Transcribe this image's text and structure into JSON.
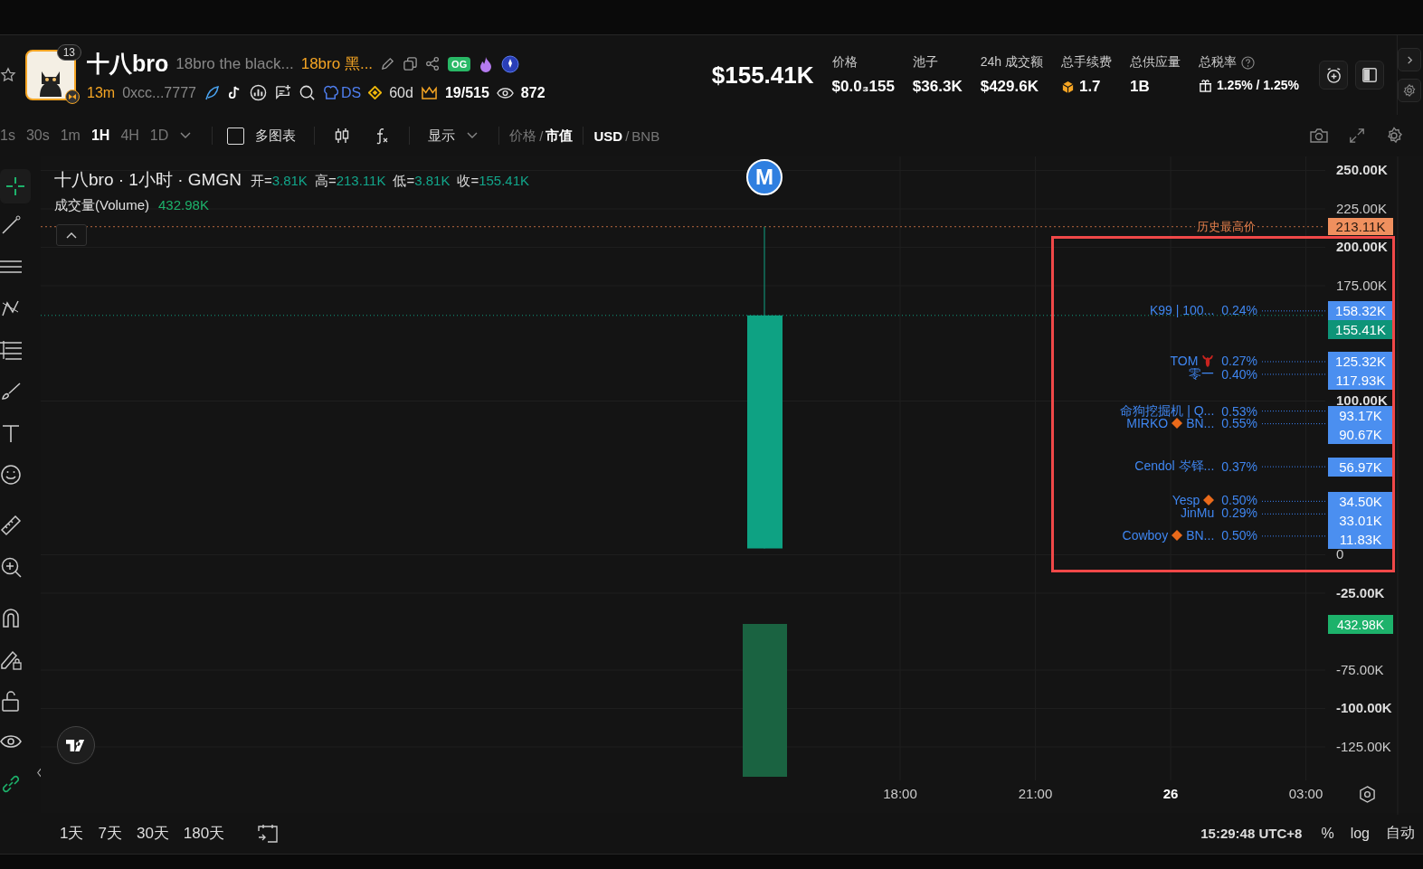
{
  "token": {
    "name": "十八bro",
    "full_name": "18bro the black...",
    "alias": "18bro 黑...",
    "badge": "OG",
    "avatar_badge": "13",
    "age": "13m",
    "address": "0xcc...7777",
    "ds_label": "DS",
    "listing_age": "60d",
    "holders_rank": "19/515",
    "views": "872"
  },
  "market_cap": "$155.41K",
  "stats": [
    {
      "label": "价格",
      "value": "$0.0₃155",
      "kind": "plain"
    },
    {
      "label": "池子",
      "value": "$36.3K",
      "kind": "plain"
    },
    {
      "label": "24h 成交额",
      "value": "$429.6K",
      "kind": "plain"
    },
    {
      "label": "总手续费",
      "value": "1.7",
      "kind": "fee"
    },
    {
      "label": "总供应量",
      "value": "1B",
      "kind": "plain"
    },
    {
      "label": "总税率",
      "value": "1.25% / 1.25%",
      "kind": "tax"
    }
  ],
  "intervals": [
    {
      "label": "1s",
      "selected": false
    },
    {
      "label": "30s",
      "selected": false
    },
    {
      "label": "1m",
      "selected": false
    },
    {
      "label": "1H",
      "selected": true
    },
    {
      "label": "4H",
      "selected": false
    },
    {
      "label": "1D",
      "selected": false
    }
  ],
  "toolbar": {
    "multi_chart": {
      "label": "多图表",
      "checked": false
    },
    "display": "显示",
    "separator": "/",
    "price_mode": [
      {
        "label": "价格",
        "selected": false
      },
      {
        "label": "市值",
        "selected": true
      }
    ],
    "currency": [
      {
        "label": "USD",
        "selected": true
      },
      {
        "label": "BNB",
        "selected": false
      }
    ]
  },
  "legend": {
    "title": "十八bro · 1小时 · GMGN",
    "ohlc": [
      {
        "label": "开=",
        "value": "3.81K"
      },
      {
        "label": "高=",
        "value": "213.11K"
      },
      {
        "label": "低=",
        "value": "3.81K"
      },
      {
        "label": "收=",
        "value": "155.41K"
      }
    ],
    "volume_label": "成交量(Volume)",
    "volume_value": "432.98K"
  },
  "chart": {
    "marker": "M",
    "ath_label": "历史最高价",
    "ath_price": "213.11K",
    "current_price": "155.41K",
    "volume_tag": "432.98K",
    "price_ticks": [
      "250.00K",
      "225.00K",
      "200.00K",
      "175.00K",
      "100.00K",
      "0",
      "-25.00K",
      "-75.00K",
      "-100.00K",
      "-125.00K"
    ],
    "time_ticks": [
      {
        "label": "18:00",
        "bold": false
      },
      {
        "label": "21:00",
        "bold": false
      },
      {
        "label": "26",
        "bold": true
      },
      {
        "label": "03:00",
        "bold": false
      }
    ],
    "holders": [
      {
        "kind": "plain",
        "name": "K99 | 100...",
        "percent": "0.24%",
        "price": "158.32K"
      },
      {
        "kind": "lobster",
        "name": "TOM",
        "percent": "0.27%",
        "price": "125.32K"
      },
      {
        "kind": "plain",
        "name": "零一",
        "percent": "0.40%",
        "price": "117.93K"
      },
      {
        "kind": "plain",
        "name": "命狗挖掘机 | Q...",
        "percent": "0.53%",
        "price": "93.17K"
      },
      {
        "kind": "diamond",
        "name": "MIRKO",
        "suffix": "BN...",
        "percent": "0.55%",
        "price": "90.67K"
      },
      {
        "kind": "plain",
        "name": "Cendol 岑铎...",
        "percent": "0.37%",
        "price": "56.97K"
      },
      {
        "kind": "diamond",
        "name": "Yesp",
        "percent": "0.50%",
        "price": "34.50K"
      },
      {
        "kind": "plain",
        "name": "JinMu",
        "percent": "0.29%",
        "price": "33.01K"
      },
      {
        "kind": "diamond",
        "name": "Cowboy",
        "suffix": "BN...",
        "percent": "0.50%",
        "price": "11.83K"
      }
    ]
  },
  "ranges": [
    "1天",
    "7天",
    "30天",
    "180天"
  ],
  "status": {
    "time": "15:29:48 UTC+8",
    "percent": "%",
    "log": "log",
    "auto": "自动"
  }
}
